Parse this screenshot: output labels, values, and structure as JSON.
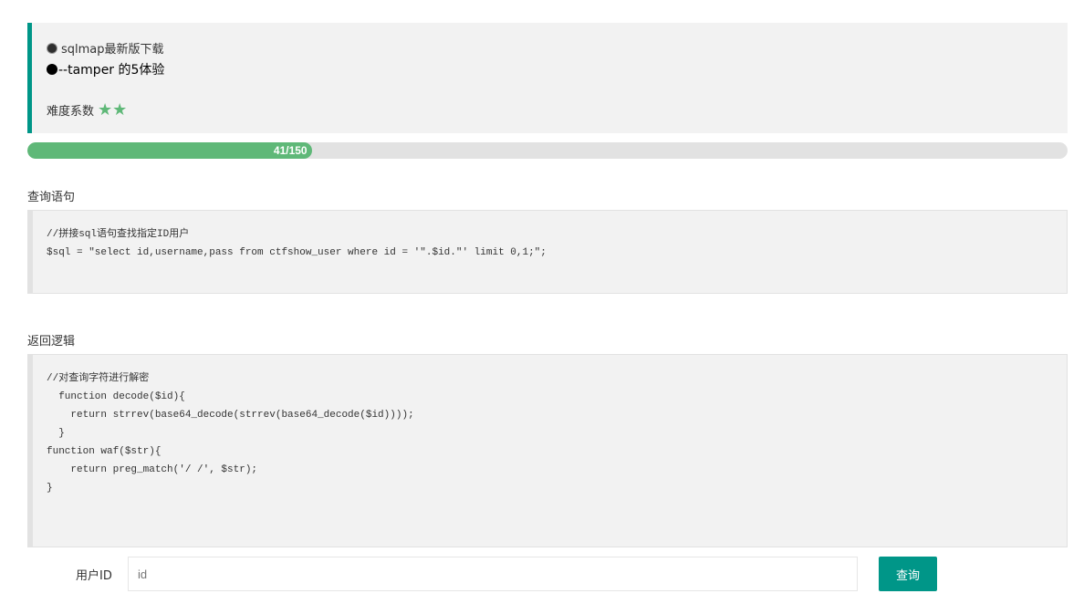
{
  "notice": {
    "line1": "sqlmap最新版下载",
    "line2": "--tamper 的5体验",
    "difficulty_label": "难度系数",
    "difficulty_stars": 2
  },
  "progress": {
    "text": "41/150",
    "current": 41,
    "total": 150,
    "color": "#5fb878"
  },
  "query_section": {
    "title": "查询语句",
    "code_lines": [
      "//拼接sql语句查找指定ID用户",
      "$sql = \"select id,username,pass from ctfshow_user where id = '\".$id.\"' limit 0,1;\";"
    ]
  },
  "return_section": {
    "title": "返回逻辑",
    "code_lines": [
      "//对查询字符进行解密",
      "  function decode($id){",
      "    return strrev(base64_decode(strrev(base64_decode($id))));",
      "  }",
      "function waf($str){",
      "    return preg_match('/ /', $str);",
      "}"
    ]
  },
  "form": {
    "label": "用户ID",
    "placeholder": "id",
    "value": "",
    "button_label": "查询"
  },
  "colors": {
    "accent": "#009688",
    "star": "#5fb878",
    "panel_bg": "#f2f2f2"
  }
}
